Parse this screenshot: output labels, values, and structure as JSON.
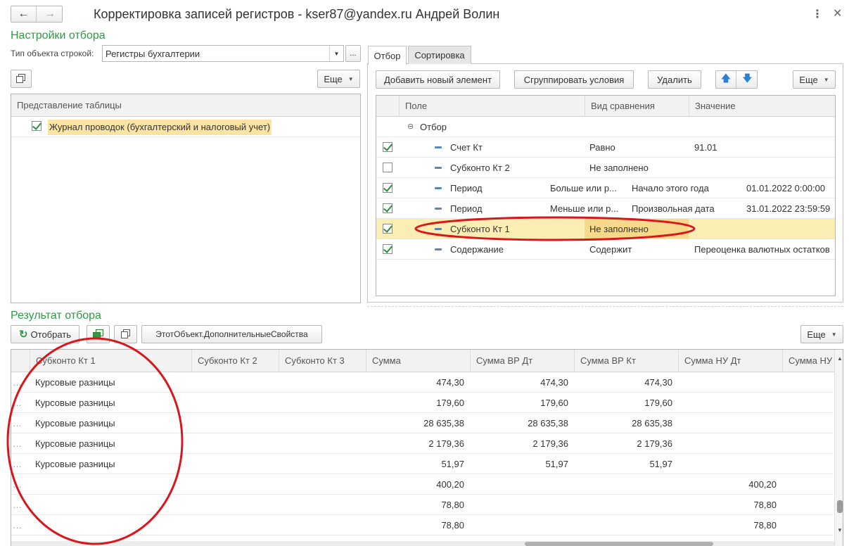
{
  "window": {
    "title": "Корректировка записей регистров - kser87@yandex.ru Андрей Волин"
  },
  "filter_settings": {
    "title": "Настройки отбора",
    "object_type_label": "Тип объекта строкой:",
    "object_type_value": "Регистры бухгалтерии",
    "more_label": "Еще",
    "table_header": "Представление таблицы",
    "tables": [
      {
        "label": "Журнал проводок (бухгалтерский и налоговый учет)",
        "checked": true
      }
    ]
  },
  "tabs": [
    {
      "label": "Отбор",
      "active": true
    },
    {
      "label": "Сортировка",
      "active": false
    }
  ],
  "filter_toolbar": {
    "add": "Добавить новый элемент",
    "group": "Сгруппировать условия",
    "delete": "Удалить",
    "more": "Еще"
  },
  "filter_grid": {
    "columns": [
      "Поле",
      "Вид сравнения",
      "Значение"
    ],
    "group": "Отбор",
    "rows": [
      {
        "checked": true,
        "field": "Счет Кт",
        "comparison": "Равно",
        "value": "91.01",
        "value2": ""
      },
      {
        "checked": false,
        "field": "Субконто Кт 2",
        "comparison": "Не заполнено",
        "value": "",
        "value2": ""
      },
      {
        "checked": true,
        "field": "Период",
        "comparison": "Больше или р...",
        "value": "Начало этого года",
        "value2": "01.01.2022 0:00:00"
      },
      {
        "checked": true,
        "field": "Период",
        "comparison": "Меньше или р...",
        "value": "Произвольная дата",
        "value2": "31.01.2022 23:59:59"
      },
      {
        "checked": true,
        "field": "Субконто Кт 1",
        "comparison": "Не заполнено",
        "value": "",
        "value2": "",
        "selected": true
      },
      {
        "checked": true,
        "field": "Содержание",
        "comparison": "Содержит",
        "value": "Переоценка валютных остатков",
        "value2": ""
      }
    ]
  },
  "result": {
    "title": "Результат отбора",
    "select_button": "Отобрать",
    "props_button": "ЭтотОбъект.ДополнительныеСвойства",
    "more": "Еще",
    "columns": [
      "Субконто Кт 1",
      "Субконто Кт 2",
      "Субконто Кт 3",
      "Сумма",
      "Сумма ВР Дт",
      "Сумма ВР Кт",
      "Сумма НУ Дт",
      "Сумма НУ"
    ],
    "rows": [
      [
        "Курсовые разницы",
        "",
        "",
        "474,30",
        "474,30",
        "474,30",
        ""
      ],
      [
        "Курсовые разницы",
        "",
        "",
        "179,60",
        "179,60",
        "179,60",
        ""
      ],
      [
        "Курсовые разницы",
        "",
        "",
        "28 635,38",
        "28 635,38",
        "28 635,38",
        ""
      ],
      [
        "Курсовые разницы",
        "",
        "",
        "2 179,36",
        "2 179,36",
        "2 179,36",
        ""
      ],
      [
        "Курсовые разницы",
        "",
        "",
        "51,97",
        "51,97",
        "51,97",
        ""
      ],
      [
        "",
        "",
        "",
        "400,20",
        "",
        "",
        "400,20"
      ],
      [
        "",
        "",
        "",
        "78,80",
        "",
        "",
        "78,80"
      ],
      [
        "",
        "",
        "",
        "78,80",
        "",
        "",
        "78,80"
      ]
    ]
  },
  "colors": {
    "section_title": "#2e9a43",
    "selected_row": "#fbeeb4",
    "annotation_red": "#d9161c"
  }
}
